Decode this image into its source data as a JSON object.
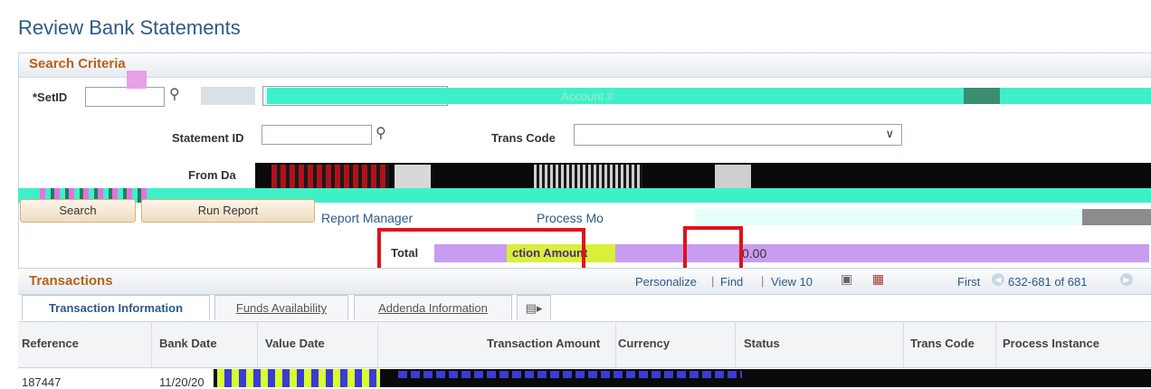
{
  "page": {
    "title": "Review Bank Statements"
  },
  "search_criteria": {
    "header": "Search Criteria",
    "setid_label": "*SetID",
    "setid_value": "",
    "account_placeholder": "Account #",
    "statement_id_label": "Statement ID",
    "statement_id_value": "",
    "trans_code_label": "Trans Code",
    "trans_code_value": "",
    "from_label": "From Da",
    "search_button": "Search",
    "run_report_button": "Run Report",
    "report_manager_link": "Report Manager",
    "process_monitor_link": "Process Mo",
    "total_label": "Total",
    "total_mid": "ction Amount",
    "total_value": "0.00"
  },
  "transactions": {
    "header": "Transactions",
    "personalize": "Personalize",
    "find": "Find",
    "view": "View 10",
    "first": "First",
    "range": "632-681 of 681",
    "tabs": [
      "Transaction Information",
      "Funds Availability",
      "Addenda Information"
    ],
    "columns": [
      "Reference",
      "Bank Date",
      "Value Date",
      "Transaction Amount",
      "Currency",
      "Status",
      "Trans Code",
      "Process Instance"
    ],
    "rows": [
      {
        "reference": "187447",
        "bank_date": "11/20/20"
      }
    ]
  },
  "colors": {
    "accent": "#2c5a8a",
    "section": "#b8611a",
    "highlight": "#e0121b"
  }
}
